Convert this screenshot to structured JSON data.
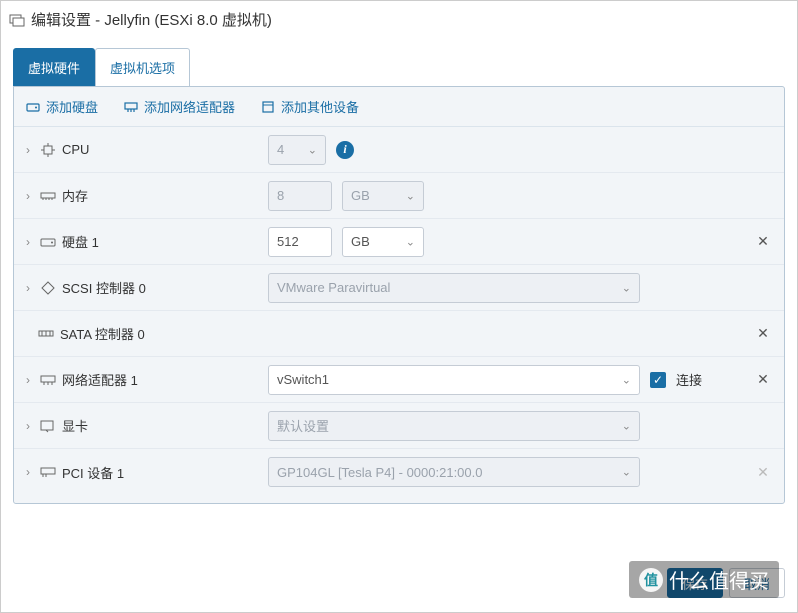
{
  "title": "编辑设置 - Jellyfin (ESXi 8.0 虚拟机)",
  "tabs": {
    "hardware": "虚拟硬件",
    "options": "虚拟机选项"
  },
  "toolbar": {
    "add_disk": "添加硬盘",
    "add_nic": "添加网络适配器",
    "add_other": "添加其他设备"
  },
  "rows": {
    "cpu": {
      "label": "CPU",
      "value": "4"
    },
    "memory": {
      "label": "内存",
      "value": "8",
      "unit": "GB"
    },
    "disk1": {
      "label": "硬盘 1",
      "value": "512",
      "unit": "GB"
    },
    "scsi": {
      "label": "SCSI 控制器 0",
      "value": "VMware Paravirtual"
    },
    "sata": {
      "label": "SATA 控制器 0"
    },
    "nic1": {
      "label": "网络适配器 1",
      "value": "vSwitch1",
      "connect": "连接"
    },
    "video": {
      "label": "显卡",
      "value": "默认设置"
    },
    "pci1": {
      "label": "PCI 设备 1",
      "value": "GP104GL [Tesla P4] - 0000:21:00.0"
    }
  },
  "footer": {
    "save": "保存",
    "cancel": "取消"
  },
  "watermark": {
    "char": "值",
    "text": "什么值得买"
  }
}
